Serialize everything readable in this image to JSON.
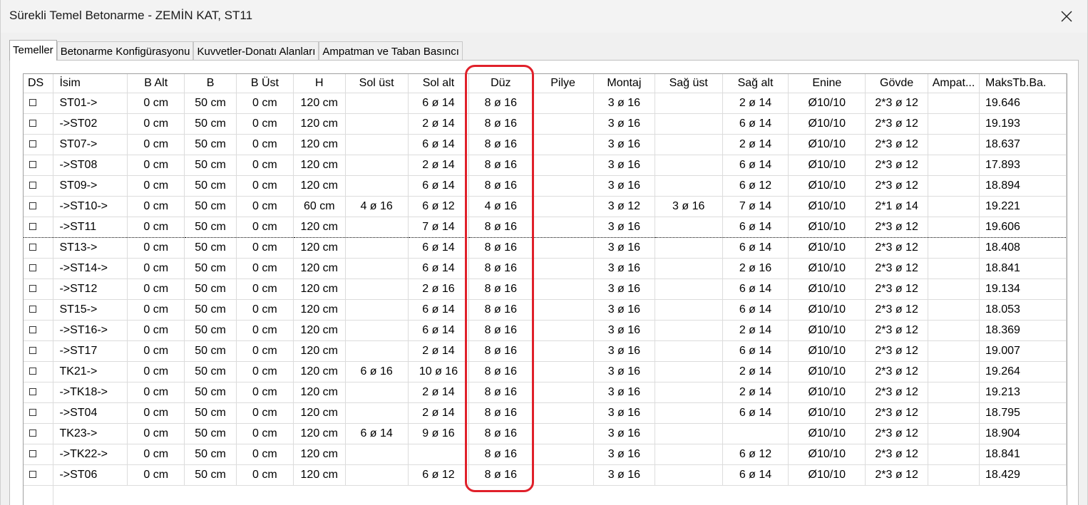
{
  "window": {
    "title": "Sürekli Temel Betonarme - ZEMİN KAT, ST11"
  },
  "icons": {
    "close": "close-icon",
    "checkbox": "checkbox-icon"
  },
  "colors": {
    "highlight": "#e0202a"
  },
  "tabs": [
    {
      "label": "Temeller",
      "active": true
    },
    {
      "label": "Betonarme Konfigürasyonu",
      "active": false
    },
    {
      "label": "Kuvvetler-Donatı Alanları",
      "active": false
    },
    {
      "label": "Ampatman ve Taban Basıncı",
      "active": false
    }
  ],
  "table": {
    "columns": [
      "DS",
      "İsim",
      "B Alt",
      "B",
      "B Üst",
      "H",
      "Sol üst",
      "Sol alt",
      "Düz",
      "Pilye",
      "Montaj",
      "Sağ üst",
      "Sağ alt",
      "Enine",
      "Gövde",
      "Ampat...",
      "MaksTb.Ba."
    ],
    "selected_row": 6,
    "rows": [
      [
        "",
        "ST01->",
        "0 cm",
        "50 cm",
        "0 cm",
        "120 cm",
        "",
        "6 ø 14",
        "8 ø 16",
        "",
        "3 ø 16",
        "",
        "2 ø 14",
        "Ø10/10",
        "2*3 ø 12",
        "",
        "19.646"
      ],
      [
        "",
        "->ST02",
        "0 cm",
        "50 cm",
        "0 cm",
        "120 cm",
        "",
        "2 ø 14",
        "8 ø 16",
        "",
        "3 ø 16",
        "",
        "6 ø 14",
        "Ø10/10",
        "2*3 ø 12",
        "",
        "19.193"
      ],
      [
        "",
        "ST07->",
        "0 cm",
        "50 cm",
        "0 cm",
        "120 cm",
        "",
        "6 ø 14",
        "8 ø 16",
        "",
        "3 ø 16",
        "",
        "2 ø 14",
        "Ø10/10",
        "2*3 ø 12",
        "",
        "18.637"
      ],
      [
        "",
        "->ST08",
        "0 cm",
        "50 cm",
        "0 cm",
        "120 cm",
        "",
        "2 ø 14",
        "8 ø 16",
        "",
        "3 ø 16",
        "",
        "6 ø 14",
        "Ø10/10",
        "2*3 ø 12",
        "",
        "17.893"
      ],
      [
        "",
        "ST09->",
        "0 cm",
        "50 cm",
        "0 cm",
        "120 cm",
        "",
        "6 ø 14",
        "8 ø 16",
        "",
        "3 ø 16",
        "",
        "6 ø 12",
        "Ø10/10",
        "2*3 ø 12",
        "",
        "18.894"
      ],
      [
        "",
        "->ST10->",
        "0 cm",
        "50 cm",
        "0 cm",
        "60 cm",
        "4 ø 16",
        "6 ø 12",
        "4 ø 16",
        "",
        "3 ø 12",
        "3 ø 16",
        "7 ø 14",
        "Ø10/10",
        "2*1 ø 14",
        "",
        "19.221"
      ],
      [
        "",
        "->ST11",
        "0 cm",
        "50 cm",
        "0 cm",
        "120 cm",
        "",
        "7 ø 14",
        "8 ø 16",
        "",
        "3 ø 16",
        "",
        "6 ø 14",
        "Ø10/10",
        "2*3 ø 12",
        "",
        "19.606"
      ],
      [
        "",
        "ST13->",
        "0 cm",
        "50 cm",
        "0 cm",
        "120 cm",
        "",
        "6 ø 14",
        "8 ø 16",
        "",
        "3 ø 16",
        "",
        "6 ø 14",
        "Ø10/10",
        "2*3 ø 12",
        "",
        "18.408"
      ],
      [
        "",
        "->ST14->",
        "0 cm",
        "50 cm",
        "0 cm",
        "120 cm",
        "",
        "6 ø 14",
        "8 ø 16",
        "",
        "3 ø 16",
        "",
        "2 ø 16",
        "Ø10/10",
        "2*3 ø 12",
        "",
        "18.841"
      ],
      [
        "",
        "->ST12",
        "0 cm",
        "50 cm",
        "0 cm",
        "120 cm",
        "",
        "2 ø 16",
        "8 ø 16",
        "",
        "3 ø 16",
        "",
        "6 ø 14",
        "Ø10/10",
        "2*3 ø 12",
        "",
        "19.134"
      ],
      [
        "",
        "ST15->",
        "0 cm",
        "50 cm",
        "0 cm",
        "120 cm",
        "",
        "6 ø 14",
        "8 ø 16",
        "",
        "3 ø 16",
        "",
        "6 ø 14",
        "Ø10/10",
        "2*3 ø 12",
        "",
        "18.053"
      ],
      [
        "",
        "->ST16->",
        "0 cm",
        "50 cm",
        "0 cm",
        "120 cm",
        "",
        "6 ø 14",
        "8 ø 16",
        "",
        "3 ø 16",
        "",
        "2 ø 14",
        "Ø10/10",
        "2*3 ø 12",
        "",
        "18.369"
      ],
      [
        "",
        "->ST17",
        "0 cm",
        "50 cm",
        "0 cm",
        "120 cm",
        "",
        "2 ø 14",
        "8 ø 16",
        "",
        "3 ø 16",
        "",
        "6 ø 14",
        "Ø10/10",
        "2*3 ø 12",
        "",
        "19.007"
      ],
      [
        "",
        "TK21->",
        "0 cm",
        "50 cm",
        "0 cm",
        "120 cm",
        "6 ø 16",
        "10 ø 16",
        "8 ø 16",
        "",
        "3 ø 16",
        "",
        "2 ø 14",
        "Ø10/10",
        "2*3 ø 12",
        "",
        "19.264"
      ],
      [
        "",
        "->TK18->",
        "0 cm",
        "50 cm",
        "0 cm",
        "120 cm",
        "",
        "2 ø 14",
        "8 ø 16",
        "",
        "3 ø 16",
        "",
        "2 ø 14",
        "Ø10/10",
        "2*3 ø 12",
        "",
        "19.213"
      ],
      [
        "",
        "->ST04",
        "0 cm",
        "50 cm",
        "0 cm",
        "120 cm",
        "",
        "2 ø 14",
        "8 ø 16",
        "",
        "3 ø 16",
        "",
        "6 ø 14",
        "Ø10/10",
        "2*3 ø 12",
        "",
        "18.795"
      ],
      [
        "",
        "TK23->",
        "0 cm",
        "50 cm",
        "0 cm",
        "120 cm",
        "6 ø 14",
        "9 ø 16",
        "8 ø 16",
        "",
        "3 ø 16",
        "",
        "",
        "Ø10/10",
        "2*3 ø 12",
        "",
        "18.904"
      ],
      [
        "",
        "->TK22->",
        "0 cm",
        "50 cm",
        "0 cm",
        "120 cm",
        "",
        "",
        "8 ø 16",
        "",
        "3 ø 16",
        "",
        "6 ø 12",
        "Ø10/10",
        "2*3 ø 12",
        "",
        "18.841"
      ],
      [
        "",
        "->ST06",
        "0 cm",
        "50 cm",
        "0 cm",
        "120 cm",
        "",
        "6 ø 12",
        "8 ø 16",
        "",
        "3 ø 16",
        "",
        "6 ø 14",
        "Ø10/10",
        "2*3 ø 12",
        "",
        "18.429"
      ]
    ]
  }
}
